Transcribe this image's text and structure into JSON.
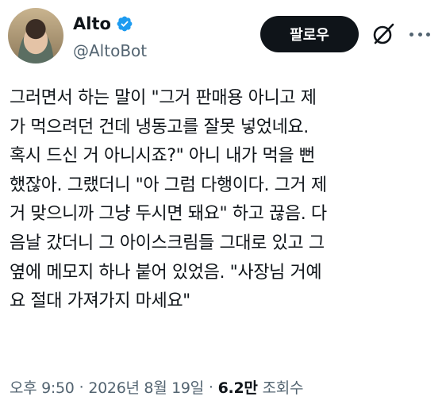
{
  "author": {
    "display_name": "Alto",
    "handle": "@AltoBot",
    "verified": true,
    "badge_color": "#1d9bf0"
  },
  "actions": {
    "follow_label": "팔로우",
    "grok_icon": "grok-icon",
    "more_icon": "more-horizontal-icon"
  },
  "post": {
    "text": "그러면서 하는 말이 \"그거 판매용 아니고 제\n가 먹으려던 건데 냉동고를 잘못 넣었네요.\n혹시 드신 거 아니시죠?\" 아니 내가 먹을 뻔\n했잖아. 그랬더니 \"아 그럼 다행이다. 그거 제\n거 맞으니까 그냥 두시면 돼요\" 하고 끊음. 다\n음날 갔더니 그 아이스크림들 그대로 있고 그\n옆에 메모지 하나 붙어 있었음. \"사장님 거예\n요 절대 가져가지 마세요\""
  },
  "meta": {
    "time": "오후 9:50",
    "separator": "·",
    "date": "2026년 8월 19일",
    "views_count": "6.2만",
    "views_label": "조회수"
  }
}
